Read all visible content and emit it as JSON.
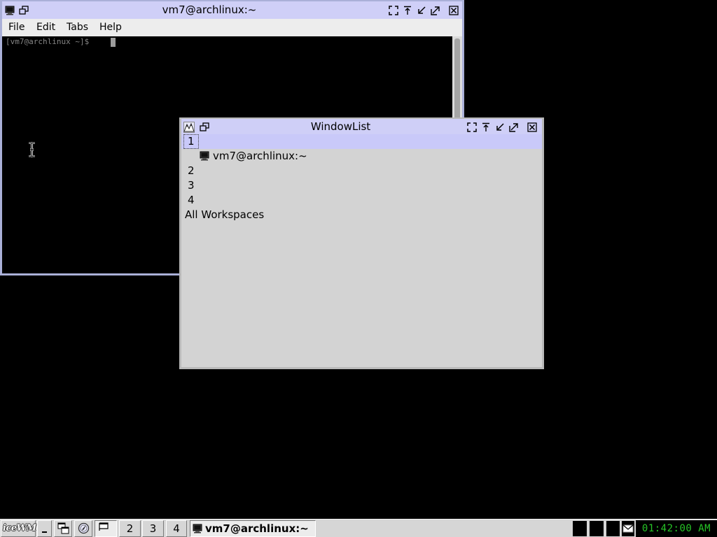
{
  "desktop": {
    "background": "#000000"
  },
  "terminal_window": {
    "title": "vm7@archlinux:~",
    "left_icons": [
      "terminal-icon",
      "restore-icon"
    ],
    "title_buttons": [
      "fullscreen-icon",
      "rollup-icon",
      "minimize-icon",
      "maximize-icon",
      "close-icon"
    ],
    "menu": [
      {
        "label": "File"
      },
      {
        "label": "Edit"
      },
      {
        "label": "Tabs"
      },
      {
        "label": "Help"
      }
    ],
    "prompt": "[vm7@archlinux ~]$ "
  },
  "window_list": {
    "title": "WindowList",
    "left_icons": [
      "icewm-logo-icon",
      "restore-icon"
    ],
    "title_buttons": [
      "fullscreen-icon",
      "rollup-icon",
      "minimize-icon",
      "maximize-icon",
      "close-icon"
    ],
    "rows": [
      {
        "type": "workspace",
        "label": "1",
        "selected": true
      },
      {
        "type": "window",
        "label": "vm7@archlinux:~",
        "icon": "terminal-icon"
      },
      {
        "type": "workspace",
        "label": "2"
      },
      {
        "type": "workspace",
        "label": "3"
      },
      {
        "type": "workspace",
        "label": "4"
      },
      {
        "type": "all",
        "label": "All Workspaces"
      }
    ]
  },
  "taskbar": {
    "start_logo_text": "iceWM",
    "quick_buttons": [
      "show-desktop-icon",
      "window-list-icon",
      "browser-icon"
    ],
    "active_workspace_icon": "workspace-preview-icon",
    "workspaces": [
      {
        "label": "2"
      },
      {
        "label": "3"
      },
      {
        "label": "4"
      }
    ],
    "task": {
      "label": "vm7@archlinux:~",
      "icon": "terminal-icon",
      "active": true
    },
    "monitors": [
      "cpu-monitor",
      "net-monitor",
      "mem-monitor"
    ],
    "mail_icon": "mail-icon",
    "clock": "01:42:00 AM"
  },
  "colors": {
    "title_bar": "#cfcff7",
    "selection": "#c9c9f9",
    "window_body": "#d3d3d3",
    "taskbar": "#d6d6d6",
    "clock_text": "#27c427"
  }
}
